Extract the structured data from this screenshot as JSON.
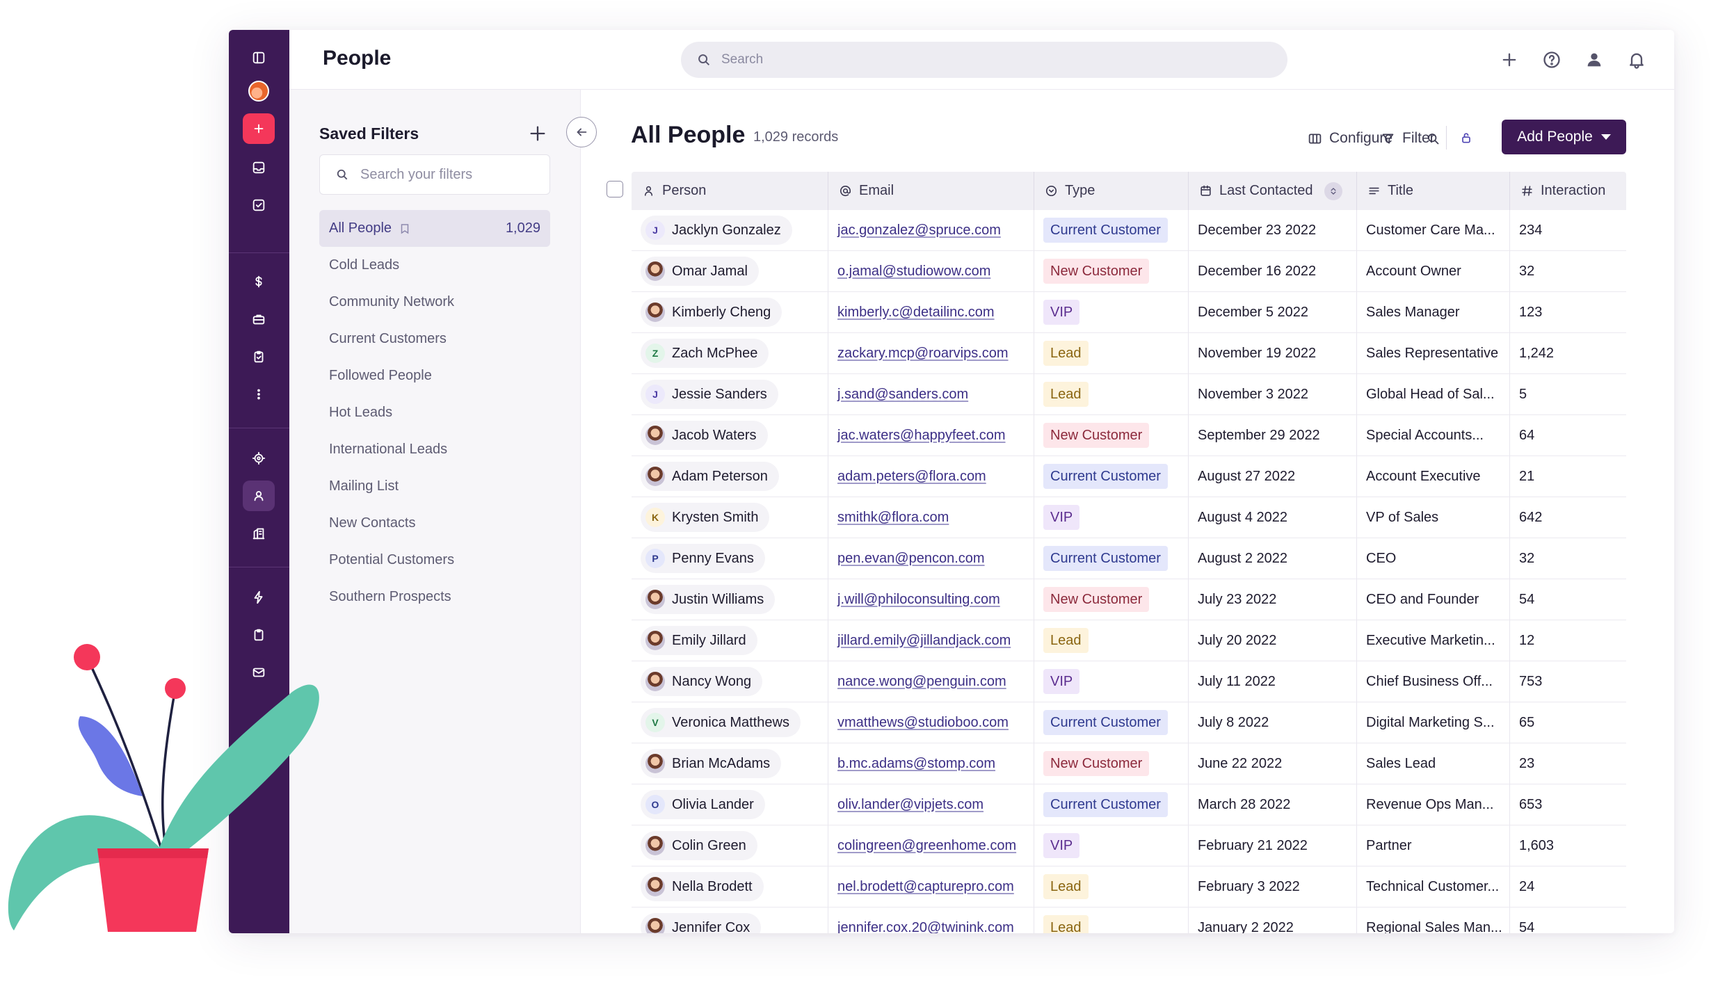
{
  "topbar": {
    "title": "People",
    "search_placeholder": "Search"
  },
  "filters": {
    "title": "Saved Filters",
    "search_placeholder": "Search your filters",
    "items": [
      {
        "label": "All People",
        "count": "1,029",
        "active": true
      },
      {
        "label": "Cold Leads"
      },
      {
        "label": "Community Network"
      },
      {
        "label": "Current Customers"
      },
      {
        "label": "Followed People"
      },
      {
        "label": "Hot Leads"
      },
      {
        "label": "International Leads"
      },
      {
        "label": "Mailing List"
      },
      {
        "label": "New Contacts"
      },
      {
        "label": "Potential Customers"
      },
      {
        "label": "Southern Prospects"
      }
    ]
  },
  "main": {
    "title": "All People",
    "records": "1,029 records",
    "configure_label": "Configure",
    "filter_label": "Filter",
    "add_label": "Add People"
  },
  "table": {
    "headers": {
      "person": "Person",
      "email": "Email",
      "type": "Type",
      "last": "Last Contacted",
      "title": "Title",
      "interaction": "Interaction"
    },
    "rows": [
      {
        "name": "Jacklyn Gonzalez",
        "initial": "J",
        "email": "jac.gonzalez@spruce.com",
        "type": "Current Customer",
        "last": "December 23 2022",
        "title": "Customer Care Ma...",
        "interaction": "234"
      },
      {
        "name": "Omar Jamal",
        "initial": "",
        "email": "o.jamal@studiowow.com",
        "type": "New Customer",
        "last": "December 16 2022",
        "title": "Account Owner",
        "interaction": "32"
      },
      {
        "name": "Kimberly Cheng",
        "initial": "",
        "email": "kimberly.c@detailinc.com",
        "type": "VIP",
        "last": "December 5 2022",
        "title": "Sales Manager",
        "interaction": "123"
      },
      {
        "name": "Zach McPhee",
        "initial": "Z",
        "email": "zackary.mcp@roarvips.com",
        "type": "Lead",
        "last": "November 19 2022",
        "title": "Sales Representative",
        "interaction": "1,242"
      },
      {
        "name": "Jessie Sanders",
        "initial": "J",
        "email": "j.sand@sanders.com",
        "type": "Lead",
        "last": "November 3 2022",
        "title": "Global Head of Sal...",
        "interaction": "5"
      },
      {
        "name": "Jacob Waters",
        "initial": "",
        "email": "jac.waters@happyfeet.com",
        "type": "New Customer",
        "last": "September 29 2022",
        "title": "Special Accounts...",
        "interaction": "64"
      },
      {
        "name": "Adam Peterson",
        "initial": "",
        "email": "adam.peters@flora.com",
        "type": "Current Customer",
        "last": "August 27 2022",
        "title": "Account Executive",
        "interaction": "21"
      },
      {
        "name": "Krysten Smith",
        "initial": "K",
        "email": "smithk@flora.com",
        "type": "VIP",
        "last": "August 4 2022",
        "title": "VP of Sales",
        "interaction": "642"
      },
      {
        "name": "Penny Evans",
        "initial": "P",
        "email": "pen.evan@pencon.com",
        "type": "Current Customer",
        "last": "August 2 2022",
        "title": "CEO",
        "interaction": "32"
      },
      {
        "name": "Justin Williams",
        "initial": "",
        "email": "j.will@philoconsulting.com",
        "type": "New Customer",
        "last": "July 23 2022",
        "title": "CEO and Founder",
        "interaction": "54"
      },
      {
        "name": "Emily Jillard",
        "initial": "",
        "email": "jillard.emily@jillandjack.com",
        "type": "Lead",
        "last": "July 20 2022",
        "title": "Executive Marketin...",
        "interaction": "12"
      },
      {
        "name": "Nancy Wong",
        "initial": "",
        "email": "nance.wong@penguin.com",
        "type": "VIP",
        "last": "July 11 2022",
        "title": "Chief Business Off...",
        "interaction": "753"
      },
      {
        "name": "Veronica Matthews",
        "initial": "V",
        "email": "vmatthews@studioboo.com",
        "type": "Current Customer",
        "last": "July 8 2022",
        "title": "Digital Marketing S...",
        "interaction": "65"
      },
      {
        "name": "Brian McAdams",
        "initial": "",
        "email": "b.mc.adams@stomp.com",
        "type": "New Customer",
        "last": "June 22 2022",
        "title": "Sales Lead",
        "interaction": "23"
      },
      {
        "name": "Olivia Lander",
        "initial": "O",
        "email": "oliv.lander@vipjets.com",
        "type": "Current Customer",
        "last": "March 28 2022",
        "title": "Revenue Ops Man...",
        "interaction": "653"
      },
      {
        "name": "Colin Green",
        "initial": "",
        "email": "colingreen@greenhome.com",
        "type": "VIP",
        "last": "February 21 2022",
        "title": "Partner",
        "interaction": "1,603"
      },
      {
        "name": "Nella Brodett",
        "initial": "",
        "email": "nel.brodett@capturepro.com",
        "type": "Lead",
        "last": "February 3 2022",
        "title": "Technical Customer...",
        "interaction": "24"
      },
      {
        "name": "Jennifer Cox",
        "initial": "",
        "email": "jennifer.cox.20@twinink.com",
        "type": "Lead",
        "last": "January 2 2022",
        "title": "Regional Sales Man...",
        "interaction": "54"
      }
    ]
  },
  "type_colors": {
    "Current Customer": {
      "bg": "#e4e7fb",
      "fg": "#2f3a8f"
    },
    "New Customer": {
      "bg": "#fde6ea",
      "fg": "#8c2a3c"
    },
    "VIP": {
      "bg": "#efe6fa",
      "fg": "#5b2d8f"
    },
    "Lead": {
      "bg": "#fdf3dc",
      "fg": "#8a6510"
    }
  },
  "initial_colors": {
    "J": {
      "bg": "#ece9fb",
      "fg": "#4a3aa3"
    },
    "Z": {
      "bg": "#e3f5ea",
      "fg": "#1f7a45"
    },
    "K": {
      "bg": "#fdf3dc",
      "fg": "#8a6510"
    },
    "P": {
      "bg": "#e4e7fb",
      "fg": "#2f3a8f"
    },
    "V": {
      "bg": "#e3f5ea",
      "fg": "#1f7a45"
    },
    "O": {
      "bg": "#e4e7fb",
      "fg": "#2f3a8f"
    }
  },
  "colors": {
    "rail": "#3d1a56",
    "accent": "#f4375a",
    "primary_button": "#3d1a56"
  }
}
